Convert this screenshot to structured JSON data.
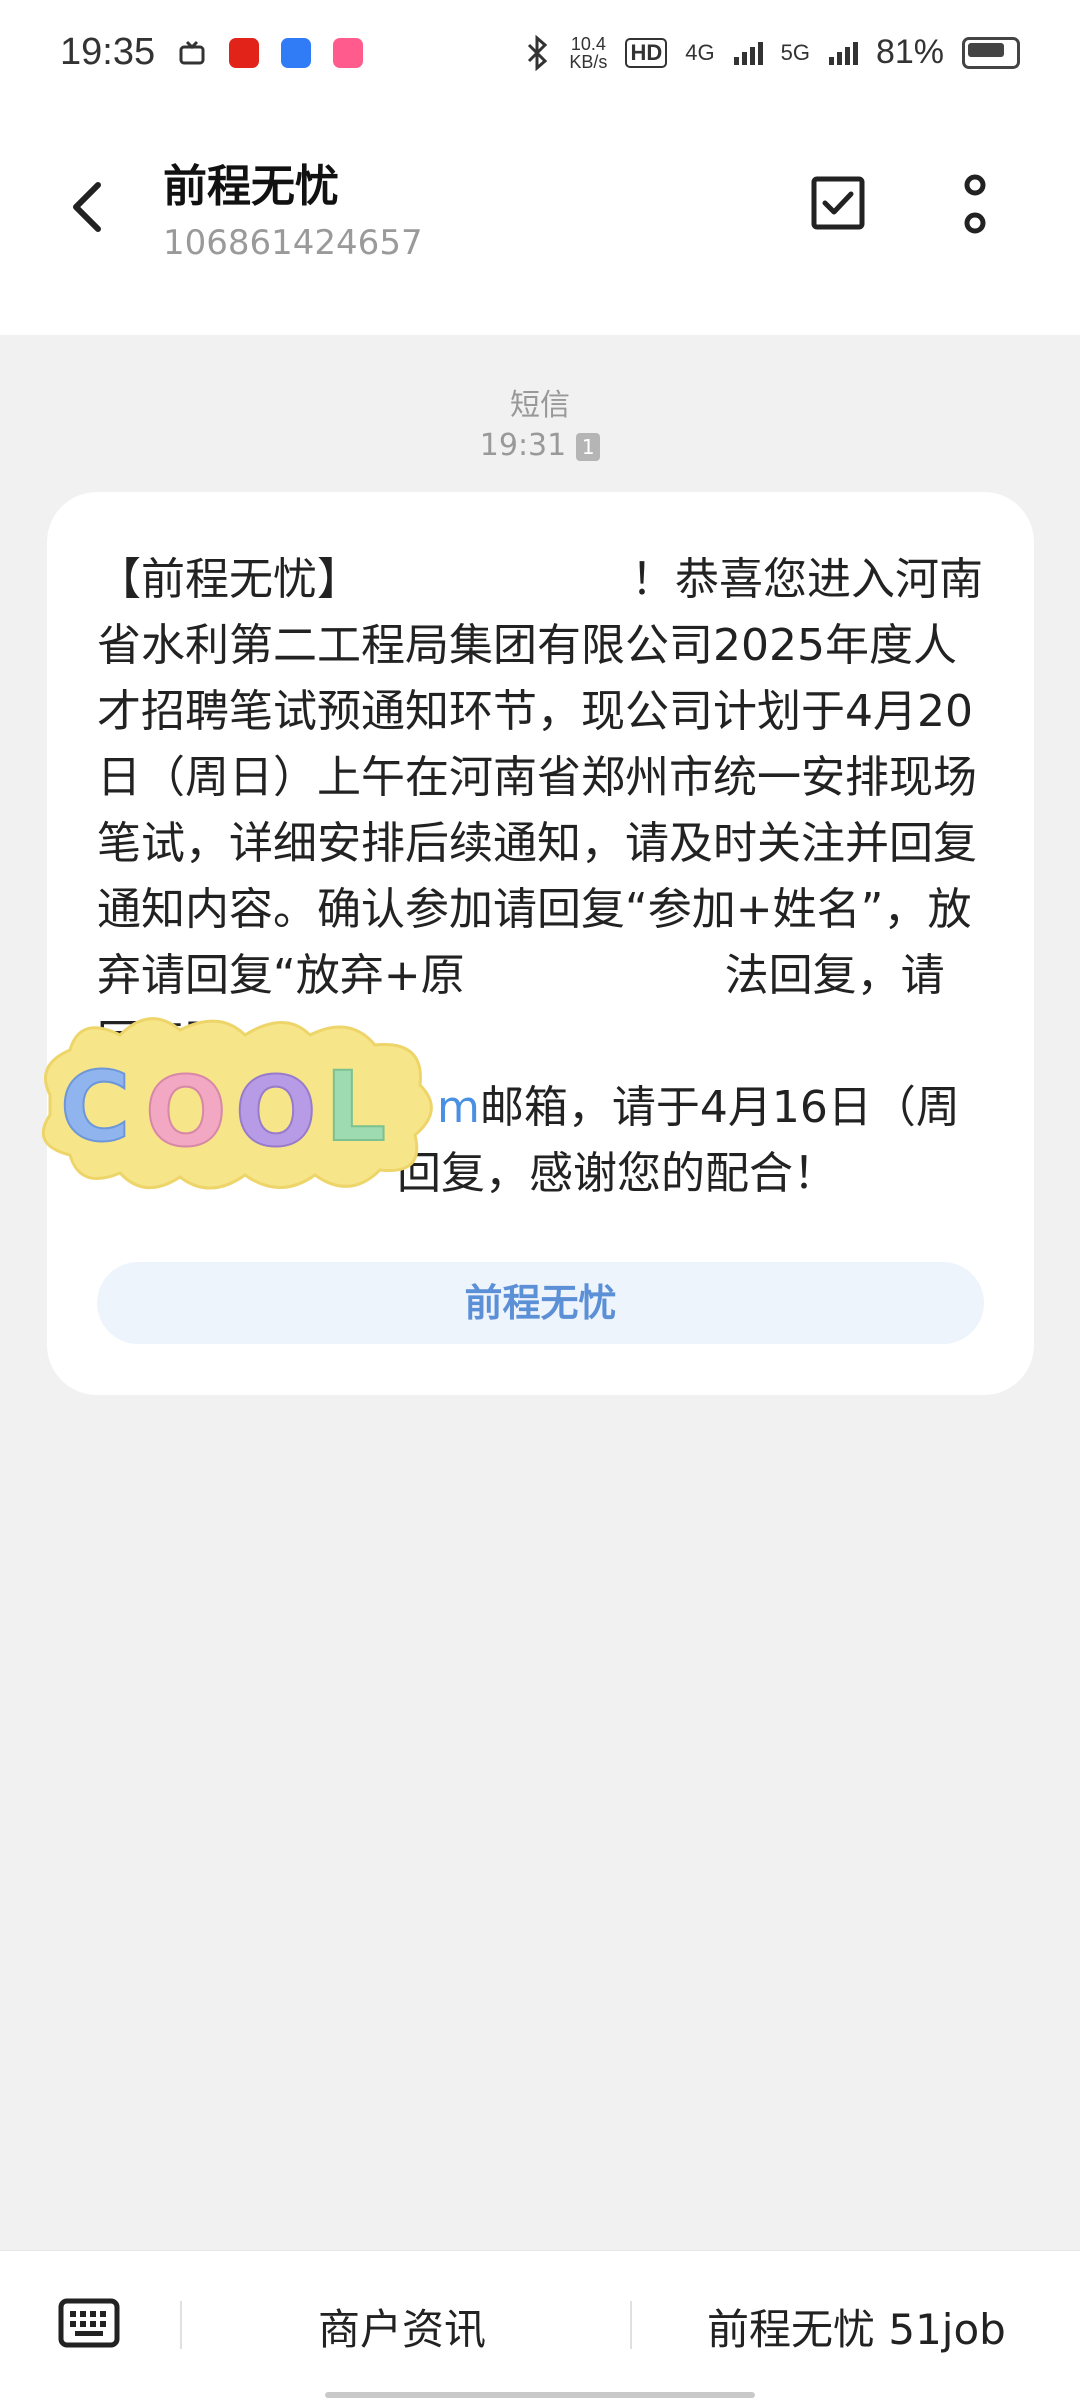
{
  "status_bar": {
    "time": "19:35",
    "net_speed_value": "10.4",
    "net_speed_unit": "KB/s",
    "hd_label": "HD",
    "net_4g": "4G",
    "net_5g": "5G",
    "battery_percent": "81%",
    "battery_level": 0.81,
    "icons": [
      "tv-icon",
      "shopping-app-icon",
      "browser-app-icon",
      "video-app-icon",
      "bluetooth-icon",
      "signal-icon",
      "battery-icon"
    ]
  },
  "header": {
    "title": "前程无忧",
    "number": "106861424657"
  },
  "conversation": {
    "type_label": "短信",
    "time": "19:31",
    "sim_slot": "1",
    "message_part1": "【前程无忧】",
    "message_part2": "！恭喜您进入河南省水利第二工程局集团有限公司2025年度人才招聘笔试预通知环节，现公司计划于4月20日（周日）上午在河南省郑州市统一安排现场笔试，详细安排后续通知，请及时关注并回复通知内容。确认参加请回复“参加+姓名”，放弃请回复“放弃+原",
    "message_part3": "法回复，请回复至",
    "email_fragment": "m",
    "message_part4": "邮箱，请于4月16日（周",
    "message_part5": "回复，感谢您的配合！",
    "action_button": "前程无忧"
  },
  "sticker": {
    "text": "COOL",
    "colors": [
      "#8fb4ee",
      "#f2a7c3",
      "#b79be6",
      "#9fdbb0"
    ],
    "background": "#f7e58a"
  },
  "bottom_bar": {
    "item1": "商户资讯",
    "item2": "前程无忧 51job"
  },
  "colors": {
    "background": "#f1f1f1",
    "accent": "#5b8fd6",
    "action_bg": "#eef4fc"
  }
}
